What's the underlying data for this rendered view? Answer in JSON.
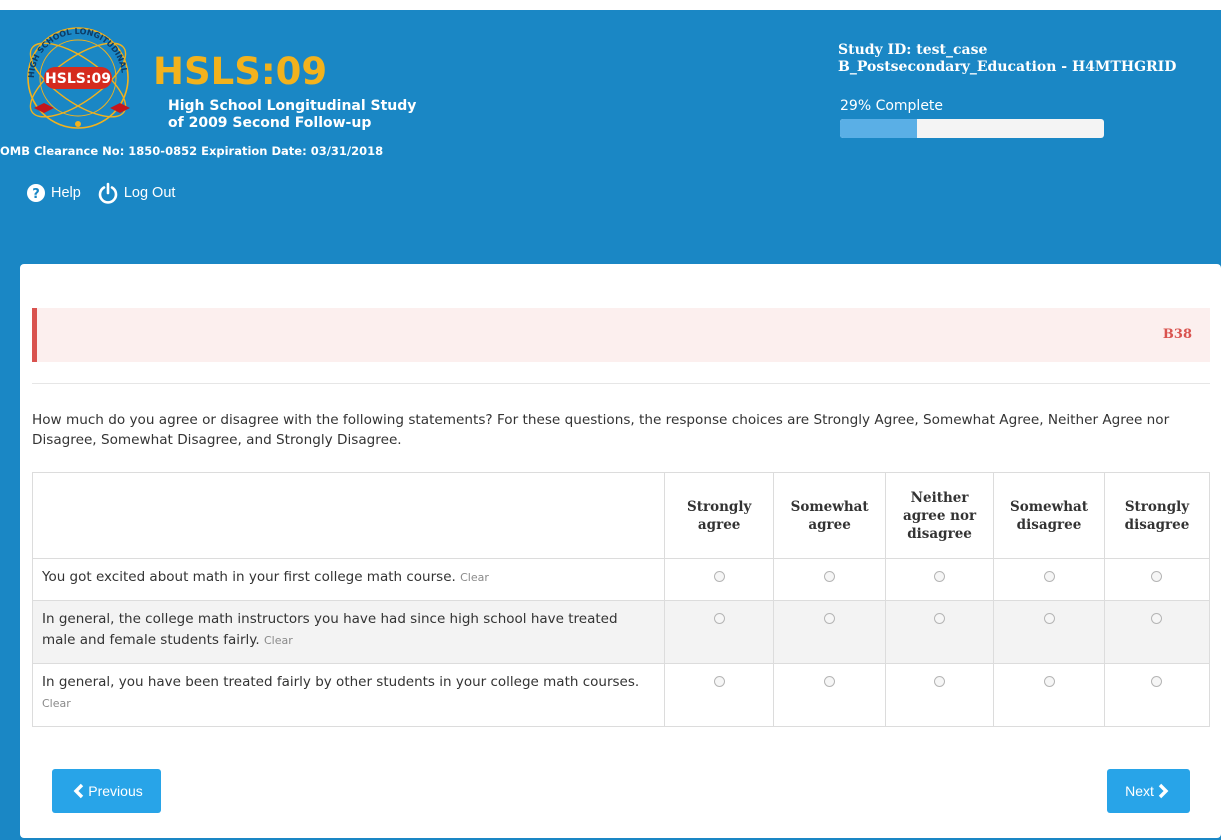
{
  "header": {
    "logo_ring_text": "HIGH SCHOOL LONGITUDINAL STUDY:2009",
    "logo_badge": "HSLS:09",
    "title": "HSLS:09",
    "subtitle_line1": "High School Longitudinal Study",
    "subtitle_line2": "of 2009 Second Follow-up",
    "omb": "OMB Clearance No: 1850-0852 Expiration Date: 03/31/2018",
    "help_label": "Help",
    "logout_label": "Log Out",
    "study_id": "Study ID: test_case",
    "section": "B_Postsecondary_Education - H4MTHGRID",
    "progress_text": "29% Complete",
    "progress_value": 0.29
  },
  "question": {
    "id": "B38",
    "text": "How much do you agree or disagree with the following statements? For these questions, the response choices are Strongly Agree, Somewhat Agree, Neither Agree nor Disagree, Somewhat Disagree, and Strongly Disagree.",
    "columns": [
      "Strongly agree",
      "Somewhat agree",
      "Neither agree nor disagree",
      "Somewhat disagree",
      "Strongly disagree"
    ],
    "rows": [
      {
        "text": "You got excited about math in your first college math course.",
        "clear": "Clear"
      },
      {
        "text": "In general, the college math instructors you have had since high school have treated male and female students fairly.",
        "clear": "Clear"
      },
      {
        "text": "In general, you have been treated fairly by other students in your college math courses.",
        "clear": "Clear"
      }
    ]
  },
  "nav": {
    "previous_label": "Previous",
    "next_label": "Next"
  },
  "colors": {
    "header_bg": "#1a87c5",
    "brand_yellow": "#f2b21d",
    "alert_red": "#d9534f",
    "button_blue": "#28a4e8"
  }
}
